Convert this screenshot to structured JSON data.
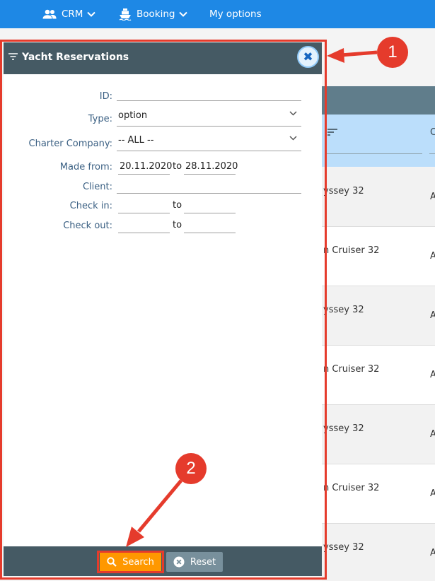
{
  "nav": {
    "crm_label": "CRM",
    "booking_label": "Booking",
    "my_options_label": "My options"
  },
  "background_rows": [
    {
      "yacht": "yssey 32",
      "edge": "A"
    },
    {
      "yacht": "n Cruiser 32",
      "edge": "A"
    },
    {
      "yacht": "yssey 32",
      "edge": "A"
    },
    {
      "yacht": "n Cruiser 32",
      "edge": "A"
    },
    {
      "yacht": "yssey 32",
      "edge": "A"
    },
    {
      "yacht": "n Cruiser 32",
      "edge": "A"
    },
    {
      "yacht": "yssey 32",
      "edge": "A"
    }
  ],
  "background_header_col": "C",
  "panel": {
    "title": "Yacht Reservations",
    "labels": {
      "id": "ID:",
      "type": "Type:",
      "charter_company": "Charter Company:",
      "made_from": "Made from:",
      "client": "Client:",
      "check_in": "Check in:",
      "check_out": "Check out:",
      "to": "to"
    },
    "values": {
      "id": "",
      "type": "option",
      "charter_company": "-- ALL --",
      "made_from_start": "20.11.2020",
      "made_from_end": "28.11.2020",
      "client": "",
      "check_in_start": "",
      "check_in_end": "",
      "check_out_start": "",
      "check_out_end": ""
    },
    "buttons": {
      "search": "Search",
      "reset": "Reset"
    }
  },
  "annotations": {
    "badge_1": "1",
    "badge_2": "2"
  },
  "colors": {
    "nav_blue": "#1e88e5",
    "panel_header": "#455a64",
    "annotation_red": "#e53b2c",
    "search_orange": "#ff9800",
    "label_blue": "#3b6083"
  }
}
